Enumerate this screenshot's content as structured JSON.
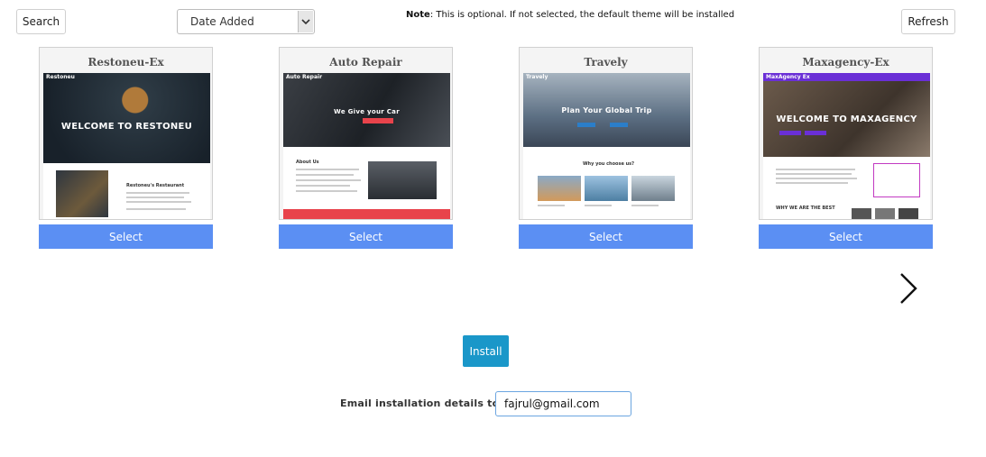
{
  "toolbar": {
    "search_label": "Search",
    "sort_selected": "Date Added",
    "note_prefix": "Note",
    "note_text": ": This is optional. If not selected, the default theme will be installed",
    "refresh_label": "Refresh"
  },
  "themes": [
    {
      "name": "Restoneu-Ex",
      "select_label": "Select",
      "hero_text": "WELCOME TO RESTONEU",
      "brand": "Restoneu",
      "section_title": "Restoneu's Restaurant",
      "accent": "#1f2a33"
    },
    {
      "name": "Auto Repair",
      "select_label": "Select",
      "hero_text": "We Give your Car",
      "brand": "Auto Repair",
      "section_title": "About Us",
      "accent": "#2a2f36"
    },
    {
      "name": "Travely",
      "select_label": "Select",
      "hero_text": "Plan Your Global Trip",
      "brand": "Travely",
      "section_title": "Why you choose us?",
      "accent": "#5b6e82"
    },
    {
      "name": "Maxagency-Ex",
      "select_label": "Select",
      "hero_text": "WELCOME TO MAXAGENCY",
      "brand": "MaxAgency Ex",
      "section_title": "WHY WE ARE THE BEST",
      "accent": "#4b3d33"
    }
  ],
  "install_label": "Install",
  "email": {
    "label": "Email installation details to :",
    "value": "fajrul@gmail.com"
  },
  "colors": {
    "select_button": "#5b8ff3",
    "install_button": "#1a97c9",
    "maxagency_header": "#6a2fd6",
    "autorepair_red": "#e8434b",
    "travely_blue": "#2b7ec9"
  }
}
